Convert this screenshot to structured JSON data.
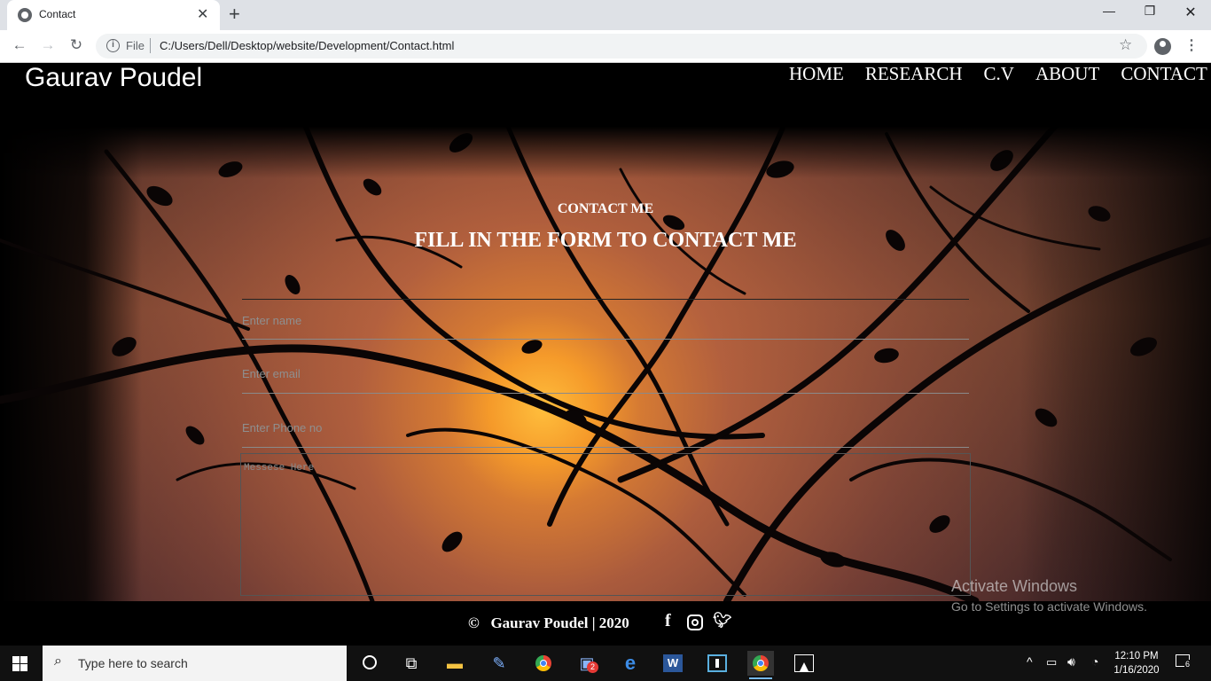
{
  "browser": {
    "tab_title": "Contact",
    "new_tab": "+",
    "omnibox": {
      "scheme_label": "File",
      "url": "C:/Users/Dell/Desktop/website/Development/Contact.html"
    }
  },
  "site": {
    "brand": "Gaurav Poudel",
    "nav": [
      "HOME",
      "RESEARCH",
      "C.V",
      "ABOUT",
      "CONTACT"
    ]
  },
  "contact": {
    "kicker": "CONTACT ME",
    "heading": "FILL IN THE FORM TO CONTACT ME",
    "name_placeholder": "Enter name",
    "email_placeholder": "Enter email",
    "phone_placeholder": "Enter Phone no",
    "message_placeholder": "Messese Here"
  },
  "footer": {
    "copyright_symbol": "©",
    "copyright_text": "Gaurav Poudel | 2020",
    "social_icons": [
      "facebook-icon",
      "instagram-icon",
      "twitter-icon"
    ]
  },
  "watermark": {
    "title": "Activate Windows",
    "subtitle": "Go to Settings to activate Windows."
  },
  "taskbar": {
    "search_placeholder": "Type here to search",
    "time": "12:10 PM",
    "date": "1/16/2020",
    "notification_count": "6",
    "badge_count": "2",
    "accent": "#76b9ed"
  }
}
